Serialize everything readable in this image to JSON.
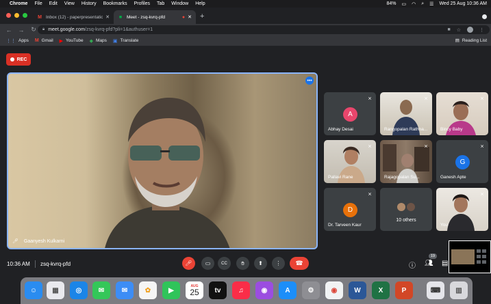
{
  "menubar": {
    "app_name": "Chrome",
    "items": [
      "File",
      "Edit",
      "View",
      "History",
      "Bookmarks",
      "Profiles",
      "Tab",
      "Window",
      "Help"
    ],
    "battery": "84%",
    "datetime": "Wed 25 Aug  10:36 AM"
  },
  "tabs": [
    {
      "title": "Inbox (12) - paperpresentation",
      "icon": "gmail-icon"
    },
    {
      "title": "Meet - zsq-kvrq-pfd",
      "icon": "meet-icon"
    }
  ],
  "address": {
    "host": "meet.google.com",
    "path": "/zsq-kvrq-pfd?pli=1&authuser=1"
  },
  "bookmarks": [
    {
      "label": "Apps",
      "icon": "apps-grid-icon"
    },
    {
      "label": "Gmail",
      "icon": "gmail-icon"
    },
    {
      "label": "YouTube",
      "icon": "youtube-icon"
    },
    {
      "label": "Maps",
      "icon": "maps-icon"
    },
    {
      "label": "Translate",
      "icon": "translate-icon"
    }
  ],
  "reading_list": "Reading List",
  "rec_label": "REC",
  "main_speaker": {
    "name": "Gaanyesh Kulkarni"
  },
  "participants": [
    {
      "name": "Abhay Desai",
      "initial": "A",
      "color": "#e8466c",
      "type": "avatar"
    },
    {
      "name": "Rangopalan Rathna...",
      "type": "video"
    },
    {
      "name": "Bincy Baby",
      "type": "video"
    },
    {
      "name": "Pallavi Rane",
      "type": "video"
    },
    {
      "name": "Rajagopalan Su...",
      "type": "video"
    },
    {
      "name": "Ganesh Apte",
      "initial": "G",
      "color": "#1a73e8",
      "type": "avatar"
    },
    {
      "name": "Dr. Tarveen Kaur",
      "initial": "D",
      "color": "#e8710a",
      "type": "avatar"
    },
    {
      "name": "10 others",
      "type": "others"
    },
    {
      "name": "You",
      "type": "video"
    }
  ],
  "meeting": {
    "time": "10:36 AM",
    "code": "zsq-kvrq-pfd",
    "participant_count": "19"
  },
  "dock": [
    {
      "name": "finder-icon",
      "color": "#2a8cf0",
      "glyph": "☺"
    },
    {
      "name": "launchpad-icon",
      "color": "#e9e9ee",
      "glyph": "▦"
    },
    {
      "name": "safari-icon",
      "color": "#1b85e8",
      "glyph": "◎"
    },
    {
      "name": "messages-icon",
      "color": "#34c759",
      "glyph": "✉"
    },
    {
      "name": "mail-icon",
      "color": "#3d8df5",
      "glyph": "✉"
    },
    {
      "name": "photos-icon",
      "color": "#f5f5f5",
      "glyph": "✿"
    },
    {
      "name": "facetime-icon",
      "color": "#30c45a",
      "glyph": "▶"
    },
    {
      "name": "calendar-icon",
      "color": "#ffffff",
      "glyph": ""
    },
    {
      "name": "apple-tv-icon",
      "color": "#111111",
      "glyph": "tv"
    },
    {
      "name": "music-icon",
      "color": "#fa2d48",
      "glyph": "♫"
    },
    {
      "name": "podcasts-icon",
      "color": "#9b4de0",
      "glyph": "◉"
    },
    {
      "name": "app-store-icon",
      "color": "#1c8ef9",
      "glyph": "A"
    },
    {
      "name": "system-preferences-icon",
      "color": "#8e8e93",
      "glyph": "⚙"
    },
    {
      "name": "chrome-icon",
      "color": "#f1f3f4",
      "glyph": "◉"
    },
    {
      "name": "word-icon",
      "color": "#2b5797",
      "glyph": "W"
    },
    {
      "name": "excel-icon",
      "color": "#1f7244",
      "glyph": "X"
    },
    {
      "name": "powerpoint-icon",
      "color": "#d24726",
      "glyph": "P"
    },
    {
      "name": "keyboard-viewer-icon",
      "color": "#e5e5ea",
      "glyph": "⌨"
    },
    {
      "name": "trash-icon",
      "color": "#d8d8dc",
      "glyph": "🗑"
    }
  ],
  "calendar": {
    "month": "AUG",
    "day": "25"
  }
}
